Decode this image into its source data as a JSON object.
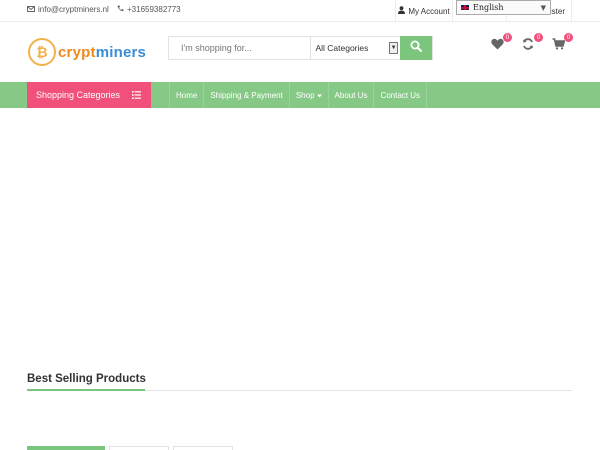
{
  "topbar": {
    "email": "info@cryptminers.nl",
    "phone": "+31659382773",
    "account_label": "My Account",
    "language": "English",
    "register_label": "ister"
  },
  "logo": {
    "coin_symbol": "₿",
    "brand": "cryptminers"
  },
  "search": {
    "placeholder": "I'm shopping for...",
    "category_selected": "All Categories"
  },
  "header_icons": {
    "wishlist_count": "0",
    "compare_count": "0",
    "cart_count": "0"
  },
  "nav": {
    "categories_label": "Shopping Categories",
    "items": [
      {
        "label": "Home"
      },
      {
        "label": "Shipping & Payment"
      },
      {
        "label": "Shop",
        "has_dropdown": true
      },
      {
        "label": "About Us"
      },
      {
        "label": "Contact Us"
      }
    ]
  },
  "section": {
    "title": "Best Selling Products"
  },
  "colors": {
    "accent_green": "#7cc57c",
    "nav_green": "#86c986",
    "accent_pink": "#f0507a",
    "logo_orange": "#f08a1c",
    "logo_blue": "#3a8ed6"
  }
}
